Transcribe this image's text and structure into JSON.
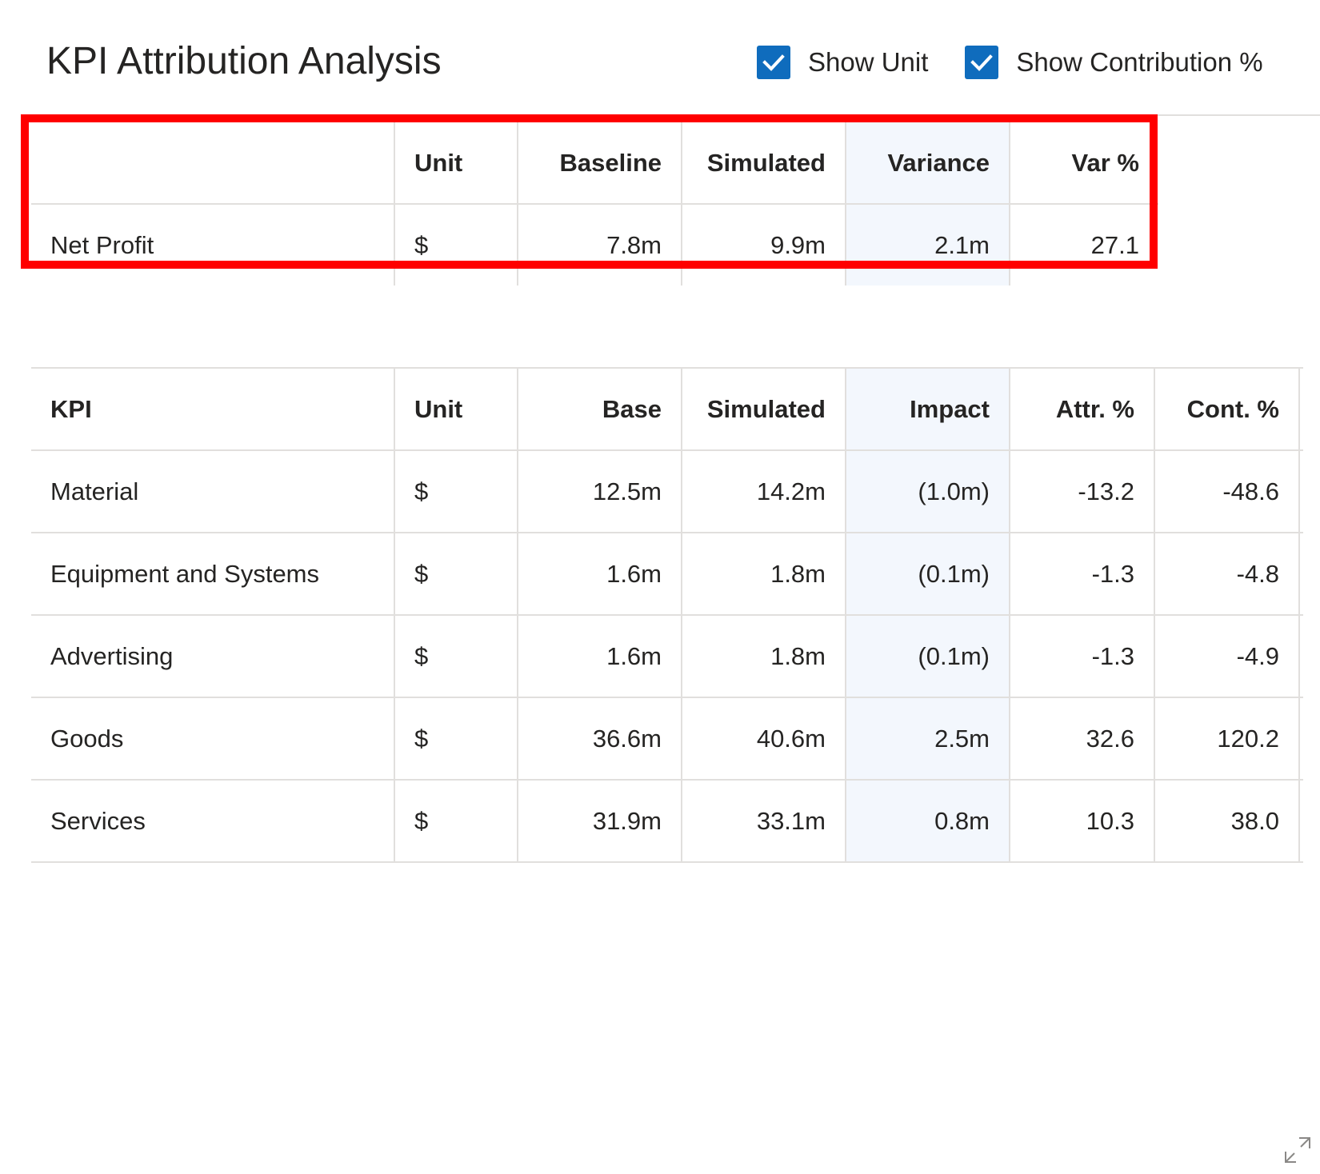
{
  "visual": {
    "title": "KPI Attribution Analysis",
    "toggles": [
      {
        "label": "Show Unit",
        "checked": true,
        "icon": "check-icon"
      },
      {
        "label": "Show Contribution %",
        "checked": true,
        "icon": "check-icon"
      }
    ],
    "expand_icon": "expand-icon"
  },
  "summary_table": {
    "headers": {
      "label": "",
      "unit": "Unit",
      "baseline": "Baseline",
      "simulated": "Simulated",
      "variance": "Variance",
      "var_pct": "Var %"
    },
    "row": {
      "label": "Net Profit",
      "unit": "$",
      "baseline": "7.8m",
      "simulated": "9.9m",
      "variance": "2.1m",
      "var_pct": "27.1"
    }
  },
  "detail_table": {
    "headers": {
      "kpi": "KPI",
      "unit": "Unit",
      "base": "Base",
      "simulated": "Simulated",
      "impact": "Impact",
      "attr_pct": "Attr. %",
      "cont_pct": "Cont. %"
    },
    "rows": [
      {
        "kpi": "Material",
        "unit": "$",
        "base": "12.5m",
        "simulated": "14.2m",
        "impact": "(1.0m)",
        "attr_pct": "-13.2",
        "cont_pct": "-48.6"
      },
      {
        "kpi": "Equipment and Systems",
        "unit": "$",
        "base": "1.6m",
        "simulated": "1.8m",
        "impact": "(0.1m)",
        "attr_pct": "-1.3",
        "cont_pct": "-4.8"
      },
      {
        "kpi": "Advertising",
        "unit": "$",
        "base": "1.6m",
        "simulated": "1.8m",
        "impact": "(0.1m)",
        "attr_pct": "-1.3",
        "cont_pct": "-4.9"
      },
      {
        "kpi": "Goods",
        "unit": "$",
        "base": "36.6m",
        "simulated": "40.6m",
        "impact": "2.5m",
        "attr_pct": "32.6",
        "cont_pct": "120.2"
      },
      {
        "kpi": "Services",
        "unit": "$",
        "base": "31.9m",
        "simulated": "33.1m",
        "impact": "0.8m",
        "attr_pct": "10.3",
        "cont_pct": "38.0"
      }
    ]
  },
  "colors": {
    "accent": "#0f6cbd",
    "highlight_border": "#ff0000",
    "shaded_column": "#f3f7fd",
    "gridline": "#e1dfdd",
    "text": "#252423"
  }
}
